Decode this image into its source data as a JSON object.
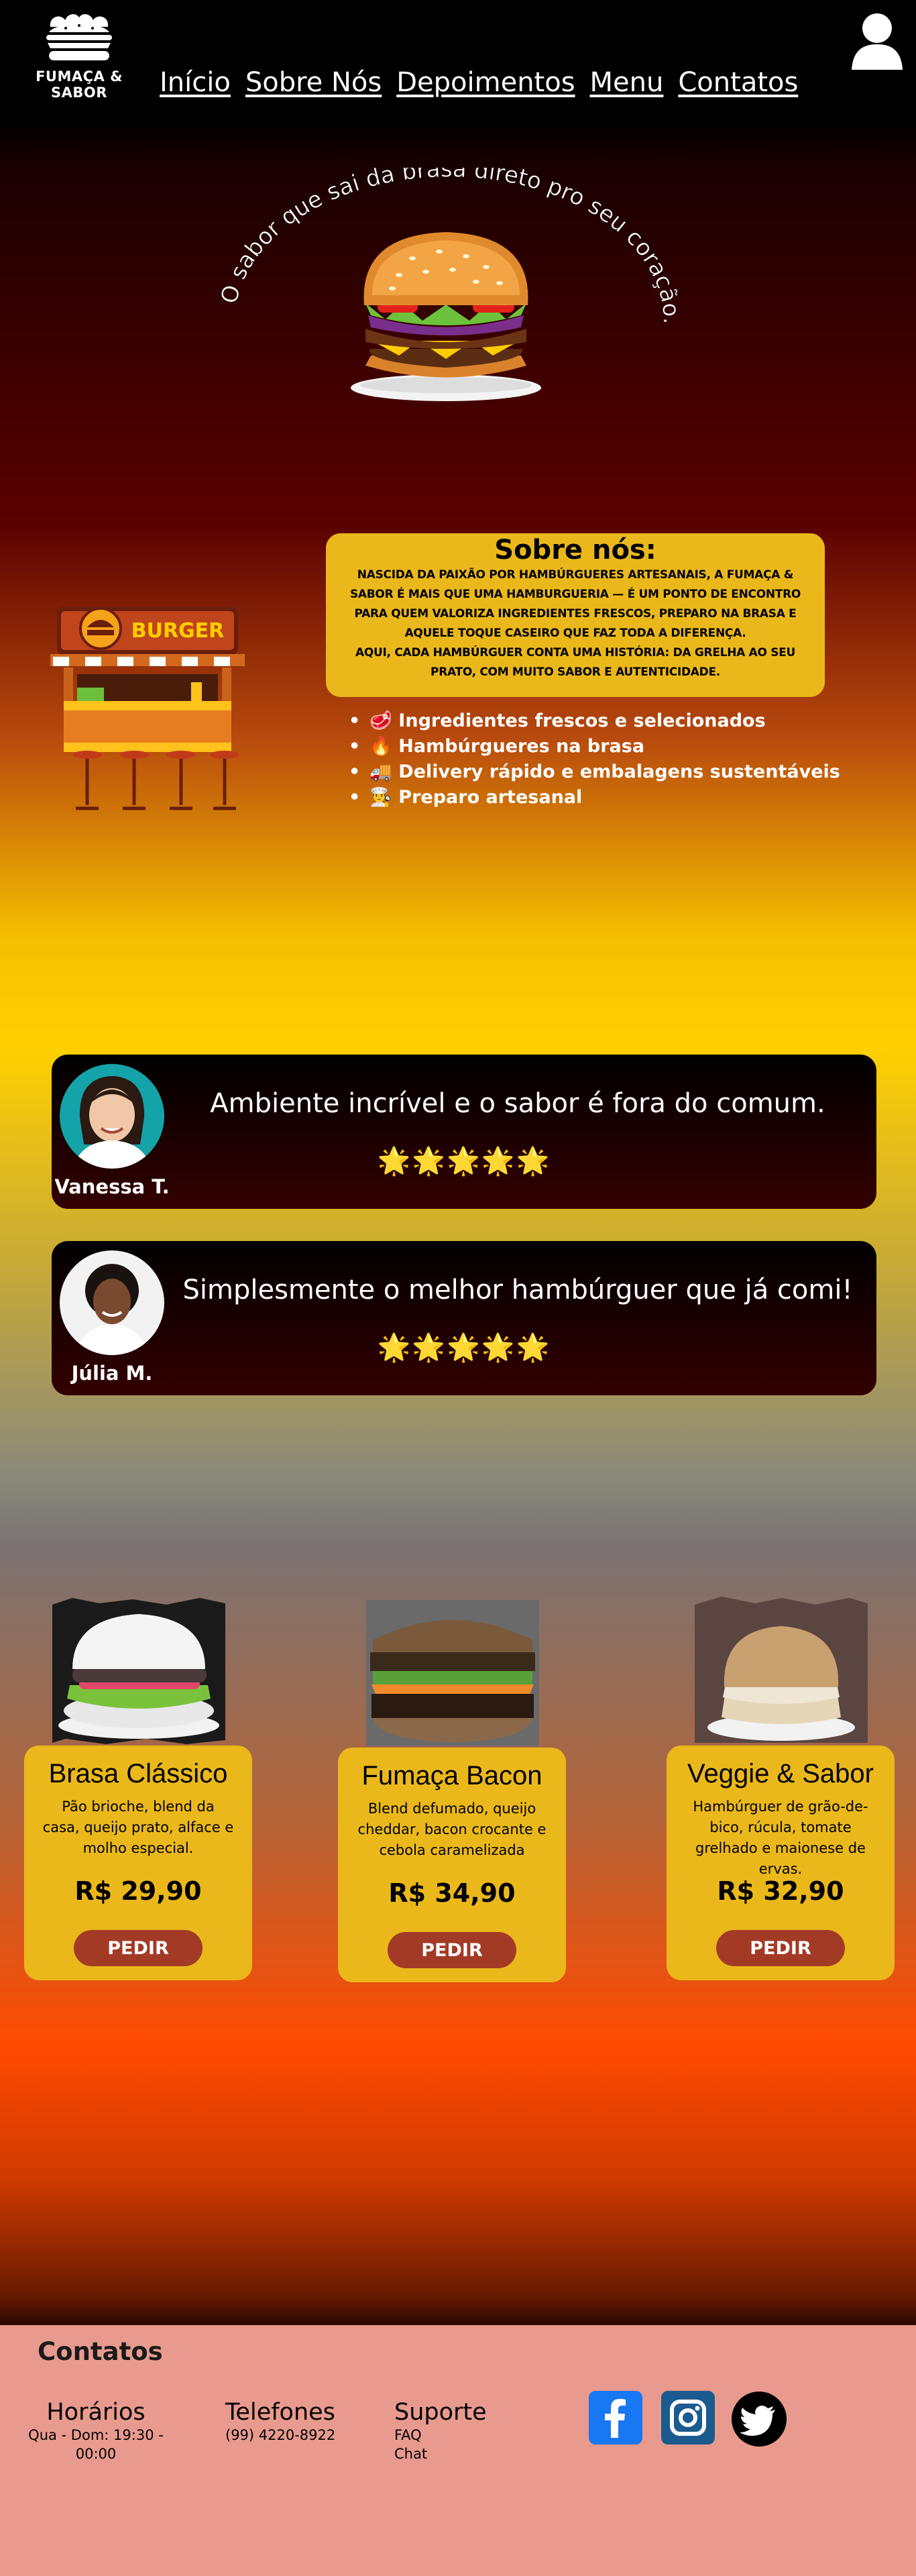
{
  "brand": {
    "name": "FUMAÇA & SABOR"
  },
  "nav": {
    "items": [
      {
        "label": "Início"
      },
      {
        "label": "Sobre Nós"
      },
      {
        "label": "Depoimentos"
      },
      {
        "label": "Menu"
      },
      {
        "label": "Contatos"
      }
    ]
  },
  "header": {
    "user_icon": "user-icon"
  },
  "hero": {
    "tagline": "O sabor que sai da brasa direto pro seu coração."
  },
  "about": {
    "title": "Sobre nós:",
    "paragraph1": "NASCIDA DA PAIXÃO POR HAMBÚRGUERES ARTESANAIS, A FUMAÇA & SABOR É MAIS QUE UMA HAMBURGUERIA — É UM PONTO DE ENCONTRO PARA QUEM VALORIZA INGREDIENTES FRESCOS, PREPARO NA BRASA E AQUELE TOQUE CASEIRO QUE FAZ TODA A DIFERENÇA.",
    "paragraph2": "AQUI, CADA HAMBÚRGUER CONTA UMA HISTÓRIA: DA GRELHA AO SEU PRATO, COM MUITO SABOR E AUTENTICIDADE.",
    "kiosk_sign": "BURGER",
    "features": [
      {
        "icon": "🥩",
        "text": "Ingredientes frescos e selecionados"
      },
      {
        "icon": "🔥",
        "text": "Hambúrgueres na brasa"
      },
      {
        "icon": "🚚",
        "text": "Delivery rápido e embalagens sustentáveis"
      },
      {
        "icon": "👨‍🍳",
        "text": "Preparo artesanal"
      }
    ]
  },
  "testimonials": [
    {
      "name": "Vanessa T.",
      "quote": "Ambiente incrível e o sabor é fora do comum.",
      "stars": "🌟🌟🌟🌟🌟",
      "rating": 5
    },
    {
      "name": "Júlia M.",
      "quote": "Simplesmente o melhor hambúrguer que já comi!",
      "stars": "🌟🌟🌟🌟🌟",
      "rating": 5
    }
  ],
  "menu": {
    "items": [
      {
        "name": "Brasa Clássico",
        "description": "Pão brioche, blend da casa, queijo prato, alface e molho especial.",
        "price": "R$ 29,90",
        "button": "PEDIR"
      },
      {
        "name": "Fumaça Bacon",
        "description": "Blend defumado, queijo cheddar, bacon crocante e cebola caramelizada",
        "price": "R$ 34,90",
        "button": "PEDIR"
      },
      {
        "name": "Veggie & Sabor",
        "description": "Hambúrguer de grão-de-bico, rúcula, tomate grelhado e maionese de ervas.",
        "price": "R$ 32,90",
        "button": "PEDIR"
      }
    ]
  },
  "footer": {
    "title": "Contatos",
    "hours": {
      "heading": "Horários",
      "value": "Qua - Dom: 19:30 - 00:00"
    },
    "phones": {
      "heading": "Telefones",
      "value": "(99) 4220-8922"
    },
    "support": {
      "heading": "Suporte",
      "links": [
        "FAQ",
        "Chat"
      ]
    },
    "social": [
      "facebook-icon",
      "instagram-icon",
      "twitter-icon"
    ],
    "colors": {
      "facebook": "#1877f2",
      "instagram": "#1c5b8f",
      "twitter": "#000000"
    }
  }
}
